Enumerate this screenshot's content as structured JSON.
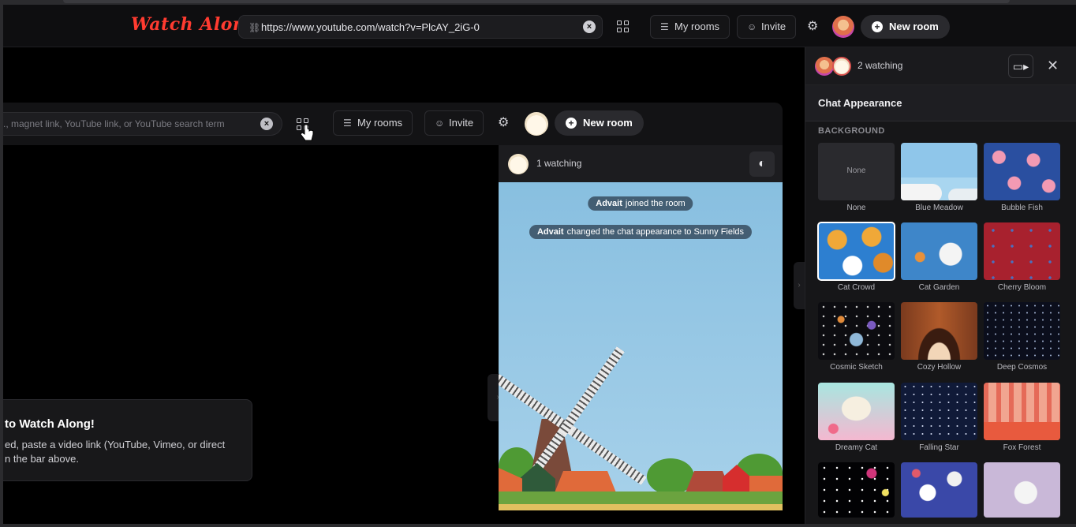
{
  "header": {
    "logo": "Watch Along",
    "url_value": "https://www.youtube.com/watch?v=PlcAY_2iG-0",
    "my_rooms_label": "My rooms",
    "invite_label": "Invite",
    "new_room_label": "New room"
  },
  "inner": {
    "search_placeholder": "., magnet link, YouTube link, or YouTube search term",
    "my_rooms_label": "My rooms",
    "invite_label": "Invite",
    "new_room_label": "New room",
    "welcome_title": "to Watch Along!",
    "welcome_line1": "ed, paste a video link (YouTube, Vimeo, or direct",
    "welcome_line2": "n the bar above.",
    "chat_watching": "1 watching",
    "messages": [
      {
        "user": "Advait",
        "text": "joined the room"
      },
      {
        "user": "Advait",
        "text": "changed the chat appearance to Sunny Fields"
      }
    ]
  },
  "panel": {
    "watching": "2 watching",
    "title": "Chat Appearance",
    "section_label": "BACKGROUND",
    "tiles": [
      {
        "label": "None",
        "inner_text": "None",
        "selected": false
      },
      {
        "label": "Blue Meadow",
        "selected": false
      },
      {
        "label": "Bubble Fish",
        "selected": false
      },
      {
        "label": "Cat Crowd",
        "selected": true
      },
      {
        "label": "Cat Garden",
        "selected": false
      },
      {
        "label": "Cherry Bloom",
        "selected": false
      },
      {
        "label": "Cosmic Sketch",
        "selected": false
      },
      {
        "label": "Cozy Hollow",
        "selected": false
      },
      {
        "label": "Deep Cosmos",
        "selected": false
      },
      {
        "label": "Dreamy Cat",
        "selected": false
      },
      {
        "label": "Falling Star",
        "selected": false
      },
      {
        "label": "Fox Forest",
        "selected": false
      }
    ]
  },
  "colors": {
    "logo": "#ff3b30",
    "background": "#000000",
    "panel": "#161618",
    "selected_outline": "#ffffff"
  }
}
